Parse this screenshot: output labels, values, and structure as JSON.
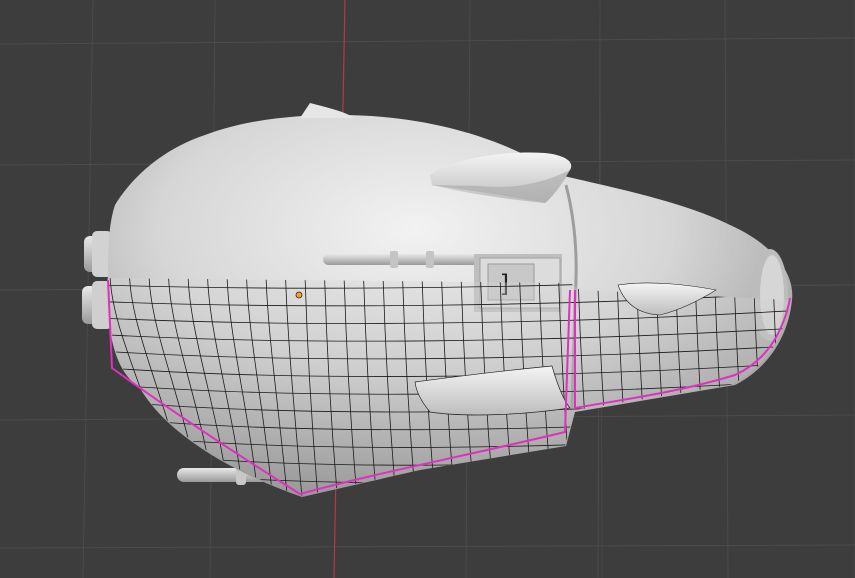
{
  "viewport": {
    "background": "#3d3d3d",
    "grid_color": "#4a4a4a",
    "x_axis_color": "#b33a45",
    "mode": "Edit Mode",
    "shading": "Solid"
  },
  "model": {
    "body_color": "#d8d8d8",
    "wire_color": "#111111",
    "seam_color": "#e030c0",
    "origin_color": "#ff9d2a",
    "panel_glyph": "]"
  }
}
